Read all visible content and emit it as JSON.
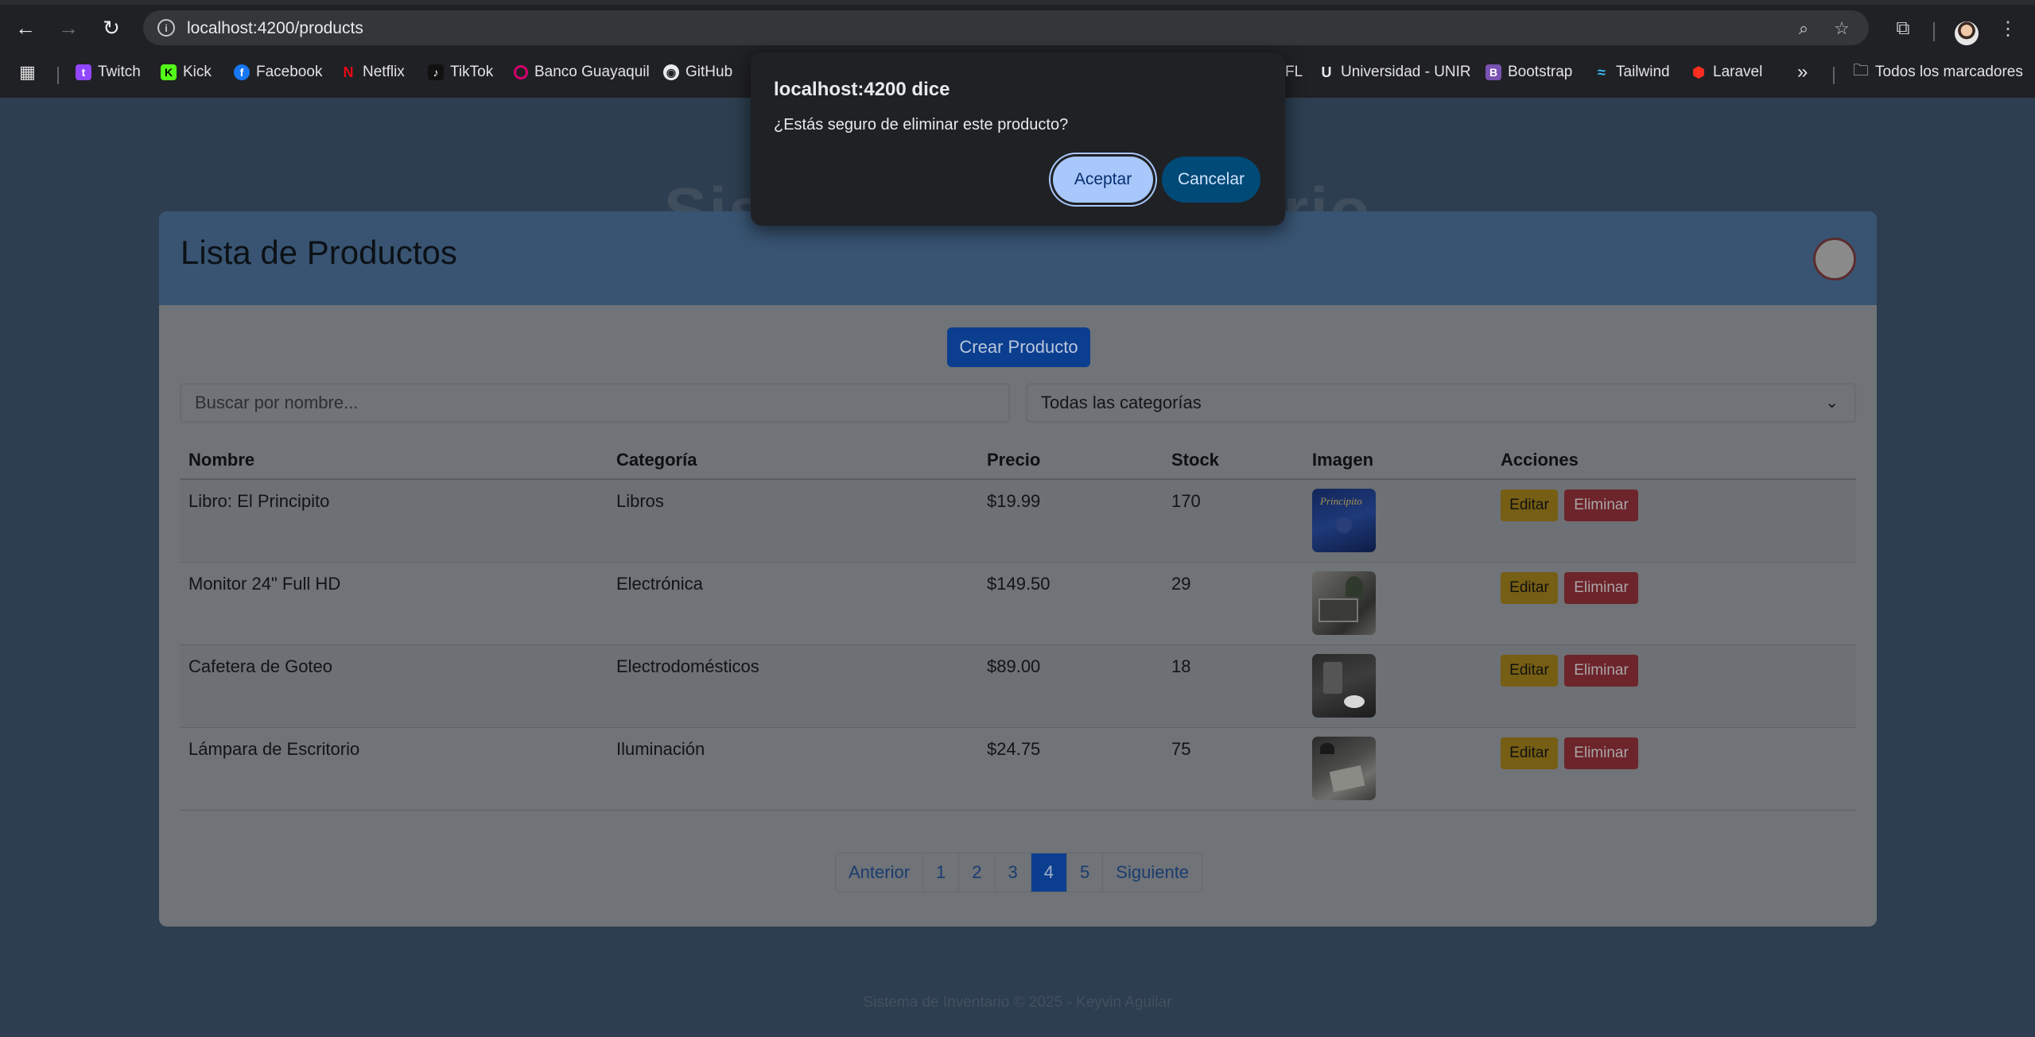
{
  "browser": {
    "url_host": "localhost:4200",
    "url_path": "/products",
    "bookmarks": [
      {
        "label": "Twitch",
        "color": "#9146ff"
      },
      {
        "label": "Kick",
        "color": "#53fc18"
      },
      {
        "label": "Facebook",
        "color": "#1877f2"
      },
      {
        "label": "Netflix",
        "color": "#e50914"
      },
      {
        "label": "TikTok",
        "color": "#111111"
      },
      {
        "label": "Banco Guayaquil",
        "color": "#d6006e"
      },
      {
        "label": "GitHub",
        "color": "#e8eaed"
      },
      {
        "label": "FL",
        "color": "#202124"
      },
      {
        "label": "Universidad - UNIR",
        "color": "#202124"
      },
      {
        "label": "Bootstrap",
        "color": "#7952b3"
      },
      {
        "label": "Tailwind",
        "color": "#38bdf8"
      },
      {
        "label": "Laravel",
        "color": "#ff2d20"
      }
    ],
    "more_bookmarks": "»",
    "all_bookmarks": "Todos los marcadores"
  },
  "page": {
    "background_title": "Sistema de Inventario",
    "card_title": "Lista de Productos",
    "create_button": "Crear Producto",
    "search_placeholder": "Buscar por nombre...",
    "category_select": "Todas las categorías",
    "columns": [
      "Nombre",
      "Categoría",
      "Precio",
      "Stock",
      "Imagen",
      "Acciones"
    ],
    "rows": [
      {
        "name": "Libro: El Principito",
        "category": "Libros",
        "price": "$19.99",
        "stock": "170",
        "image": "book-cover"
      },
      {
        "name": "Monitor 24\" Full HD",
        "category": "Electrónica",
        "price": "$149.50",
        "stock": "29",
        "image": "monitor-photo"
      },
      {
        "name": "Cafetera de Goteo",
        "category": "Electrodomésticos",
        "price": "$89.00",
        "stock": "18",
        "image": "coffee-photo"
      },
      {
        "name": "Lámpara de Escritorio",
        "category": "Iluminación",
        "price": "$24.75",
        "stock": "75",
        "image": "lamp-photo"
      }
    ],
    "edit_label": "Editar",
    "delete_label": "Eliminar",
    "pagination": {
      "prev": "Anterior",
      "pages": [
        "1",
        "2",
        "3",
        "4",
        "5"
      ],
      "active": "4",
      "next": "Siguiente"
    },
    "footer": "Sistema de Inventario © 2025 - Keyvin Aguilar"
  },
  "dialog": {
    "title": "localhost:4200 dice",
    "message": "¿Estás seguro de eliminar este producto?",
    "accept": "Aceptar",
    "cancel": "Cancelar"
  }
}
